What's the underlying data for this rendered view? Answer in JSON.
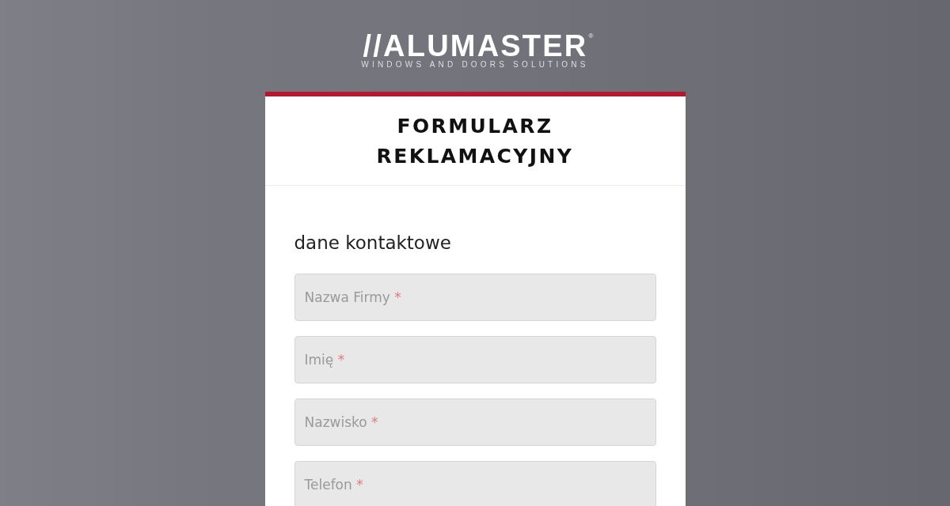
{
  "logo": {
    "wordmark": "//ALUMASTER",
    "registered": "®",
    "tagline": "WINDOWS AND DOORS SOLUTIONS"
  },
  "form": {
    "title": "FORMULARZ REKLAMACYJNY",
    "section": {
      "heading": "dane kontaktowe",
      "fields": [
        {
          "placeholder": "Nazwa Firmy",
          "required_mark": "*"
        },
        {
          "placeholder": "Imię",
          "required_mark": "*"
        },
        {
          "placeholder": "Nazwisko",
          "required_mark": "*"
        },
        {
          "placeholder": "Telefon",
          "required_mark": "*"
        }
      ]
    }
  }
}
